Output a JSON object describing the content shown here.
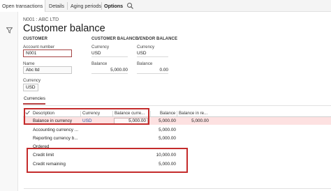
{
  "tabs": [
    {
      "label": "Open transactions",
      "bold": false
    },
    {
      "label": "Details",
      "bold": false
    },
    {
      "label": "Aging periods",
      "bold": false
    },
    {
      "label": "Options",
      "bold": true
    }
  ],
  "header": {
    "record": "N001 : ABC LTD",
    "title": "Customer balance"
  },
  "sections": {
    "customer": "CUSTOMER",
    "customer_balance": "CUSTOMER BALANCE",
    "vendor_balance": "VENDOR BALANCE"
  },
  "fields": {
    "account_number": {
      "label": "Account number",
      "value": "N001"
    },
    "name": {
      "label": "Name",
      "value": "Abc ltd"
    },
    "currency": {
      "label": "Currency",
      "value": "USD"
    },
    "cb_currency": {
      "label": "Currency",
      "value": "USD"
    },
    "cb_balance": {
      "label": "Balance",
      "value": "5,000.00"
    },
    "vb_currency": {
      "label": "Currency",
      "value": "USD"
    },
    "vb_balance": {
      "label": "Balance",
      "value": "0.00"
    }
  },
  "currencies_tab": "Currencies",
  "grid": {
    "columns": [
      "Description",
      "Currency",
      "Balance curre...",
      "Balance",
      "Balance in re..."
    ],
    "rows": [
      {
        "description": "Balance in currency",
        "currency": "USD",
        "balance_currency": "5,000.00",
        "balance": "5,000.00",
        "balance_reporting": "5,000.00",
        "selected": true
      },
      {
        "description": "Accounting currency ...",
        "currency": "",
        "balance_currency": "",
        "balance": "5,000.00",
        "balance_reporting": "",
        "selected": false
      },
      {
        "description": "Reporting currency b...",
        "currency": "",
        "balance_currency": "",
        "balance": "5,000.00",
        "balance_reporting": "",
        "selected": false
      },
      {
        "description": "Ordered",
        "currency": "",
        "balance_currency": "",
        "balance": "",
        "balance_reporting": "",
        "selected": false
      },
      {
        "description": "Credit limit",
        "currency": "",
        "balance_currency": "",
        "balance": "10,000.00",
        "balance_reporting": "",
        "selected": false
      },
      {
        "description": "Credit remaining",
        "currency": "",
        "balance_currency": "",
        "balance": "5,000.00",
        "balance_reporting": "",
        "selected": false
      }
    ]
  },
  "colors": {
    "highlight": "#c42b2b",
    "selected_row": "#fde1e1",
    "link": "#2b5ea8"
  },
  "icons": [
    "search-icon",
    "filter-icon",
    "checkmark-icon"
  ]
}
